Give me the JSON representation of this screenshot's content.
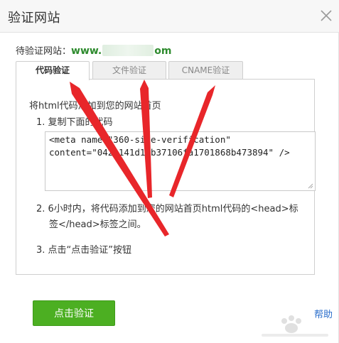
{
  "dialog": {
    "title": "验证网站",
    "site_label": "待验证网站：",
    "site_prefix": "www.",
    "site_suffix": "om"
  },
  "tabs": [
    {
      "label": "代码验证",
      "active": true
    },
    {
      "label": "文件验证",
      "active": false
    },
    {
      "label": "CNAME验证",
      "active": false
    }
  ],
  "content": {
    "intro": "将html代码添加到您的网站首页",
    "step1": "1. 复制下面的代码",
    "code_line1": "<meta name=\"360-site-verification\"",
    "code_line2": "content=\"042a141d19b37106fa1701868b473894\" />",
    "step2_line1": "2. 6小时内，将代码添加到您的网站首页html代码的<head>标",
    "step2_line2": "签</head>标签之间。",
    "step3": "3. 点击“点击验证”按钮"
  },
  "footer": {
    "verify_button": "点击验证",
    "help_link": "帮助"
  },
  "colors": {
    "accent_green": "#4caf22",
    "site_green": "#2e8b2e",
    "link_blue": "#2a6ecb",
    "annotation_red": "#e8262a"
  },
  "icons": {
    "close": "close-icon",
    "resize": "resize-grip-icon"
  }
}
